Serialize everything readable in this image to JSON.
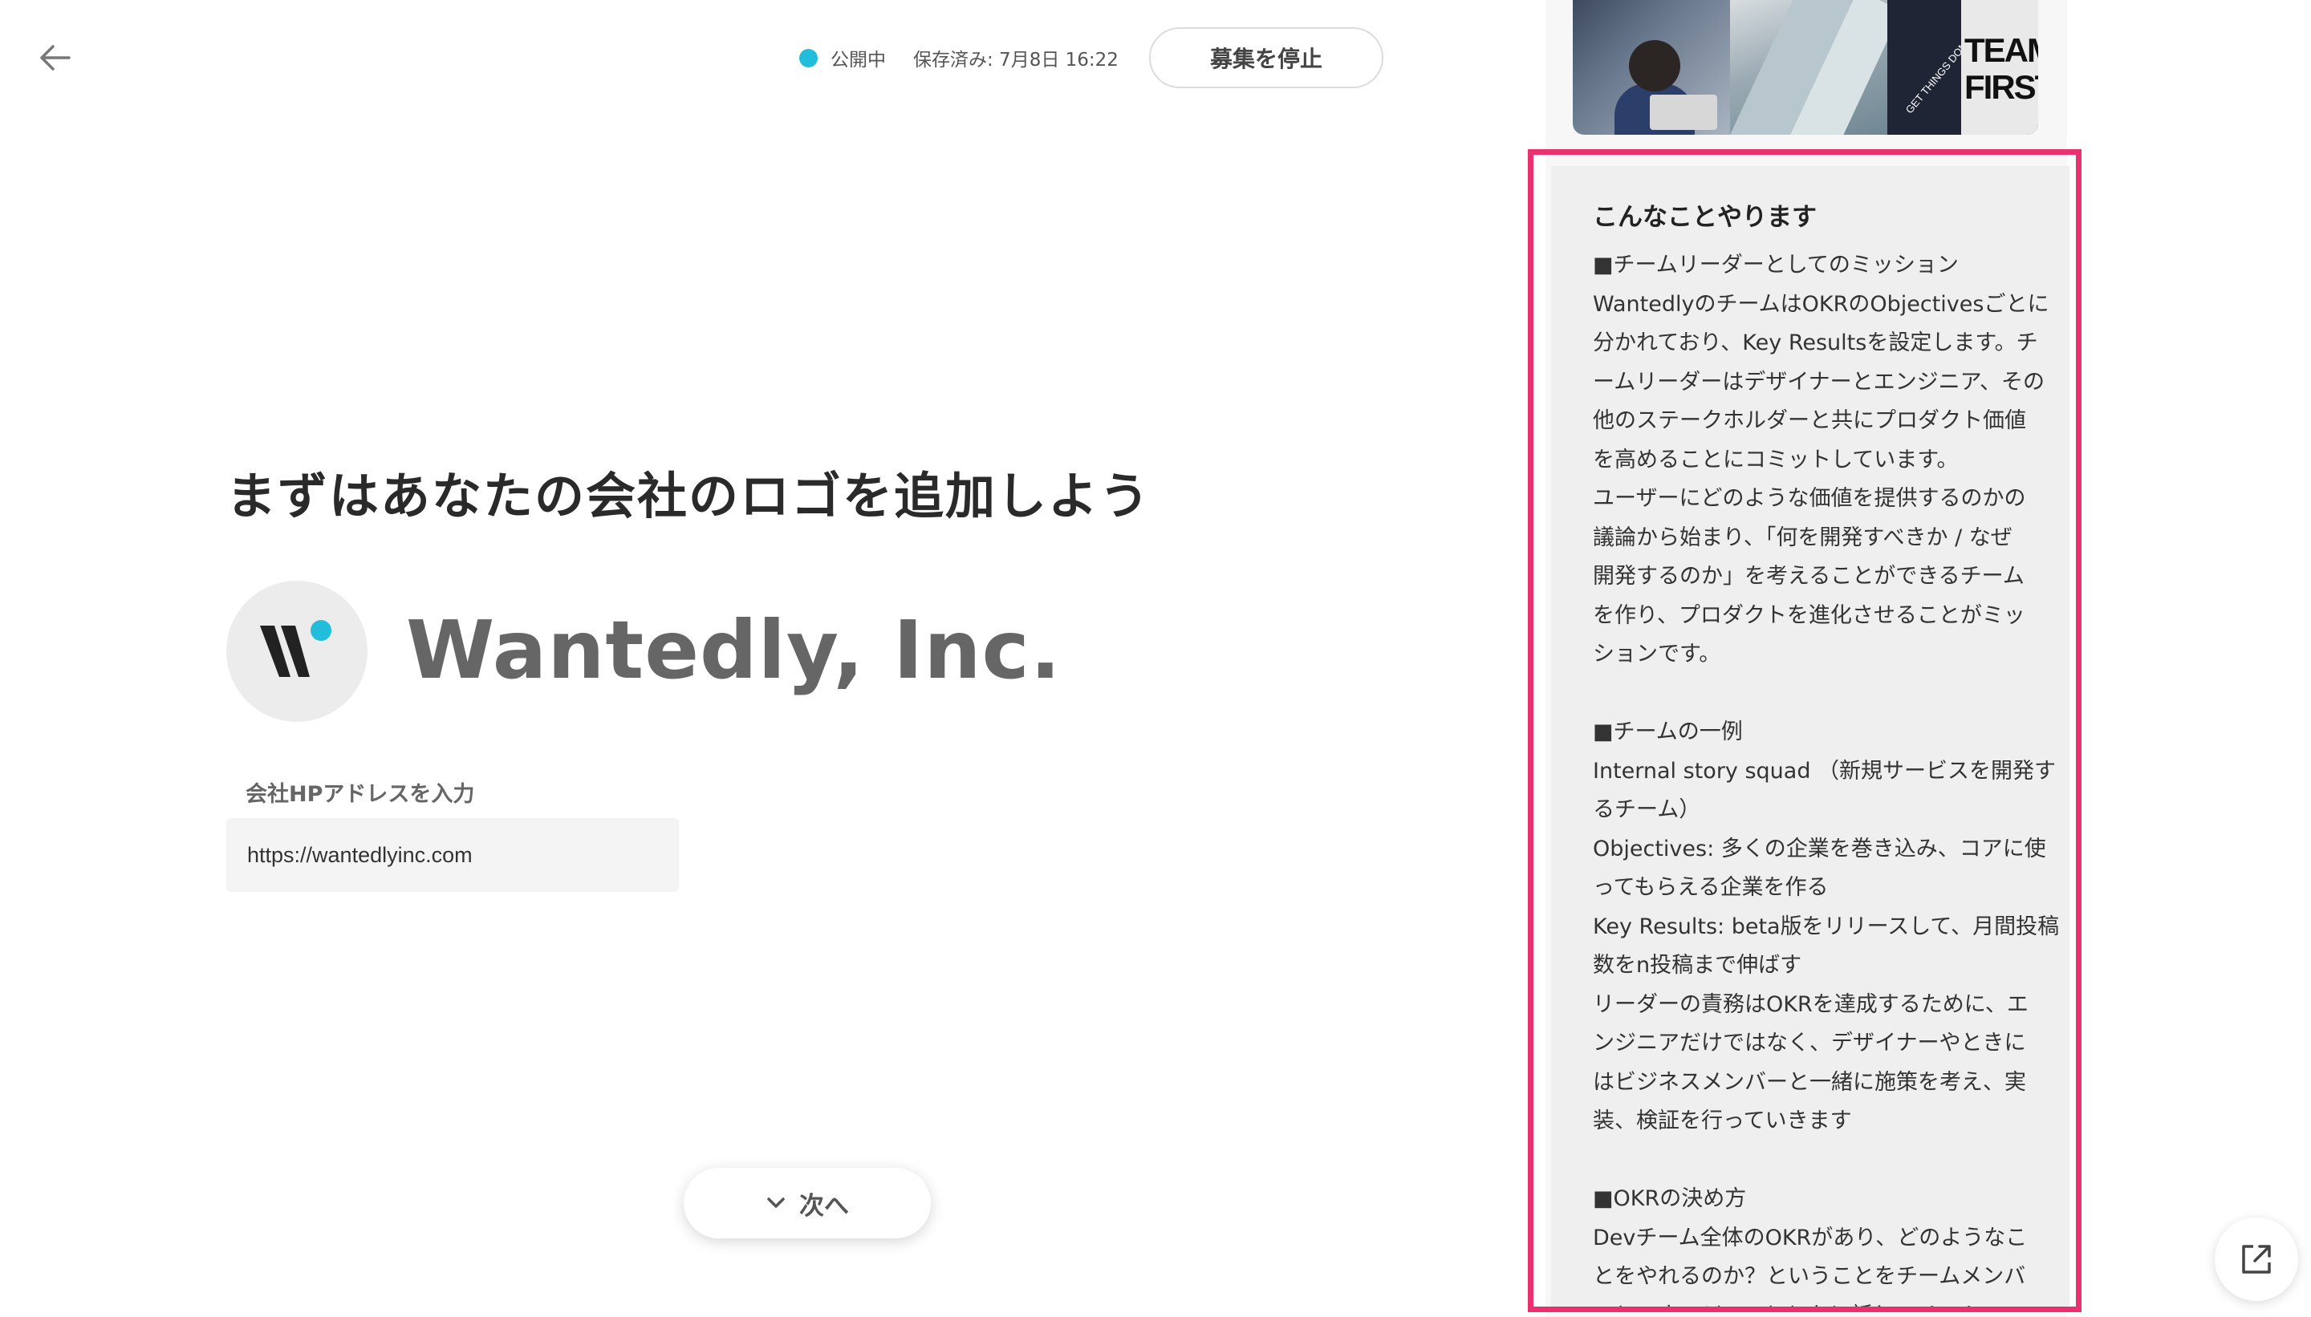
{
  "header": {
    "status_label": "公開中",
    "saved_label": "保存済み: 7月8日 16:22",
    "stop_button_label": "募集を停止"
  },
  "main": {
    "heading": "まずはあなたの会社のロゴを追加しよう",
    "company_name": "Wantedly, Inc.",
    "hp_label": "会社HPアドレスを入力",
    "hp_value": "https://wantedlyinc.com",
    "next_button_label": "次へ"
  },
  "preview": {
    "hero_book_text_1": "GET THINGS DONE",
    "hero_book_text_2": "TEAM FIRST",
    "section_title": "こんなことやります",
    "lines": [
      "■チームリーダーとしてのミッション",
      "WantedlyのチームはOKRのObjectivesごとに",
      "分かれており、Key Resultsを設定します。チ",
      "ームリーダーはデザイナーとエンジニア、その",
      "他のステークホルダーと共にプロダクト価値",
      "を高めることにコミットしています。",
      "ユーザーにどのような価値を提供するのかの",
      "議論から始まり、「何を開発すべきか / なぜ",
      "開発するのか」を考えることができるチーム",
      "を作り、プロダクトを進化させることがミッ",
      "ションです。",
      "",
      "■チームの一例",
      "Internal story squad （新規サービスを開発す",
      "るチーム）",
      "Objectives: 多くの企業を巻き込み、コアに使",
      "ってもらえる企業を作る",
      "Key Results: beta版をリリースして、月間投稿",
      "数をn投稿まで伸ばす",
      "リーダーの責務はOKRを達成するために、エ",
      "ンジニアだけではなく、デザイナーやときに",
      "はビジネスメンバーと一緒に施策を考え、実",
      "装、検証を行っていきます",
      "",
      "■OKRの決め方",
      "Devチーム全体のOKRがあり、どのようなこ",
      "とをやれるのか？ということをチームメンバ",
      "ーとマネージャーとともに話し、チームの"
    ]
  },
  "colors": {
    "status_dot": "#21bddb",
    "highlight_border": "#e8316e",
    "logo_dot": "#21bddb"
  },
  "icons": [
    "back-arrow-icon",
    "chevron-down-icon",
    "external-link-icon",
    "wantedly-logo"
  ]
}
